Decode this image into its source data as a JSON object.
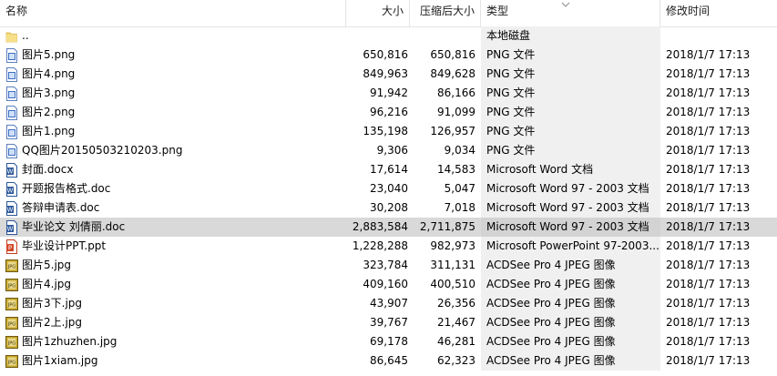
{
  "columns": {
    "name": "名称",
    "size": "大小",
    "packed": "压缩后大小",
    "type": "类型",
    "modified": "修改时间"
  },
  "colors": {
    "selected_row": "#d9d9d9",
    "type_column_bg": "#f0f0f0",
    "header_border": "#e5e5e5"
  },
  "files": [
    {
      "icon": "folder-up-icon",
      "name": "..",
      "size": "",
      "packed": "",
      "type": "本地磁盘",
      "modified": ""
    },
    {
      "icon": "png-file-icon",
      "name": "图片5.png",
      "size": "650,816",
      "packed": "650,816",
      "type": "PNG 文件",
      "modified": "2018/1/7 17:13"
    },
    {
      "icon": "png-file-icon",
      "name": "图片4.png",
      "size": "849,963",
      "packed": "849,628",
      "type": "PNG 文件",
      "modified": "2018/1/7 17:13"
    },
    {
      "icon": "png-file-icon",
      "name": "图片3.png",
      "size": "91,942",
      "packed": "86,166",
      "type": "PNG 文件",
      "modified": "2018/1/7 17:13"
    },
    {
      "icon": "png-file-icon",
      "name": "图片2.png",
      "size": "96,216",
      "packed": "91,099",
      "type": "PNG 文件",
      "modified": "2018/1/7 17:13"
    },
    {
      "icon": "png-file-icon",
      "name": "图片1.png",
      "size": "135,198",
      "packed": "126,957",
      "type": "PNG 文件",
      "modified": "2018/1/7 17:13"
    },
    {
      "icon": "png-file-icon",
      "name": "QQ图片20150503210203.png",
      "size": "9,306",
      "packed": "9,034",
      "type": "PNG 文件",
      "modified": "2018/1/7 17:13"
    },
    {
      "icon": "word-file-icon",
      "name": "封面.docx",
      "size": "17,614",
      "packed": "14,583",
      "type": "Microsoft Word 文档",
      "modified": "2018/1/7 17:13"
    },
    {
      "icon": "word-file-icon",
      "name": "开题报告格式.doc",
      "size": "23,040",
      "packed": "5,047",
      "type": "Microsoft Word 97 - 2003 文档",
      "modified": "2018/1/7 17:13"
    },
    {
      "icon": "word-file-icon",
      "name": "答辩申请表.doc",
      "size": "30,208",
      "packed": "7,018",
      "type": "Microsoft Word 97 - 2003 文档",
      "modified": "2018/1/7 17:13"
    },
    {
      "icon": "word-file-icon",
      "name": "毕业论文 刘倩丽.doc",
      "size": "2,883,584",
      "packed": "2,711,875",
      "type": "Microsoft Word 97 - 2003 文档",
      "modified": "2018/1/7 17:13",
      "selected": true
    },
    {
      "icon": "powerpoint-file-icon",
      "name": "毕业设计PPT.ppt",
      "size": "1,228,288",
      "packed": "982,973",
      "type": "Microsoft PowerPoint 97-2003...",
      "modified": "2018/1/7 17:13"
    },
    {
      "icon": "jpeg-file-icon",
      "name": "图片5.jpg",
      "size": "323,784",
      "packed": "311,131",
      "type": "ACDSee Pro 4 JPEG 图像",
      "modified": "2018/1/7 17:13"
    },
    {
      "icon": "jpeg-file-icon",
      "name": "图片4.jpg",
      "size": "409,160",
      "packed": "400,510",
      "type": "ACDSee Pro 4 JPEG 图像",
      "modified": "2018/1/7 17:13"
    },
    {
      "icon": "jpeg-file-icon",
      "name": "图片3下.jpg",
      "size": "43,907",
      "packed": "26,356",
      "type": "ACDSee Pro 4 JPEG 图像",
      "modified": "2018/1/7 17:13"
    },
    {
      "icon": "jpeg-file-icon",
      "name": "图片2上.jpg",
      "size": "39,767",
      "packed": "21,467",
      "type": "ACDSee Pro 4 JPEG 图像",
      "modified": "2018/1/7 17:13"
    },
    {
      "icon": "jpeg-file-icon",
      "name": "图片1zhuzhen.jpg",
      "size": "69,178",
      "packed": "46,281",
      "type": "ACDSee Pro 4 JPEG 图像",
      "modified": "2018/1/7 17:13"
    },
    {
      "icon": "jpeg-file-icon",
      "name": "图片1xiam.jpg",
      "size": "86,645",
      "packed": "62,323",
      "type": "ACDSee Pro 4 JPEG 图像",
      "modified": "2018/1/7 17:13"
    }
  ]
}
